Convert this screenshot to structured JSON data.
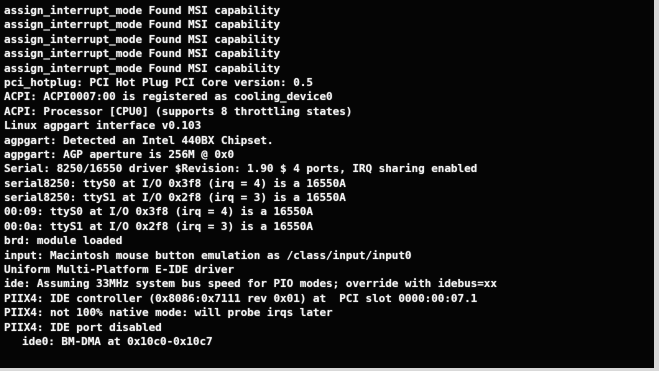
{
  "console": {
    "lines": [
      "assign_interrupt_mode Found MSI capability",
      "assign_interrupt_mode Found MSI capability",
      "assign_interrupt_mode Found MSI capability",
      "assign_interrupt_mode Found MSI capability",
      "assign_interrupt_mode Found MSI capability",
      "pci_hotplug: PCI Hot Plug PCI Core version: 0.5",
      "ACPI: ACPI0007:00 is registered as cooling_device0",
      "ACPI: Processor [CPU0] (supports 8 throttling states)",
      "Linux agpgart interface v0.103",
      "agpgart: Detected an Intel 440BX Chipset.",
      "agpgart: AGP aperture is 256M @ 0x0",
      "Serial: 8250/16550 driver $Revision: 1.90 $ 4 ports, IRQ sharing enabled",
      "serial8250: ttyS0 at I/O 0x3f8 (irq = 4) is a 16550A",
      "serial8250: ttyS1 at I/O 0x2f8 (irq = 3) is a 16550A",
      "00:09: ttyS0 at I/O 0x3f8 (irq = 4) is a 16550A",
      "00:0a: ttyS1 at I/O 0x2f8 (irq = 3) is a 16550A",
      "brd: module loaded",
      "input: Macintosh mouse button emulation as /class/input/input0",
      "Uniform Multi-Platform E-IDE driver",
      "ide: Assuming 33MHz system bus speed for PIO modes; override with idebus=xx",
      "PIIX4: IDE controller (0x8086:0x7111 rev 0x01) at  PCI slot 0000:00:07.1",
      "PIIX4: not 100% native mode: will probe irqs later",
      "PIIX4: IDE port disabled",
      "ide0: BM-DMA at 0x10c0-0x10c7"
    ]
  }
}
